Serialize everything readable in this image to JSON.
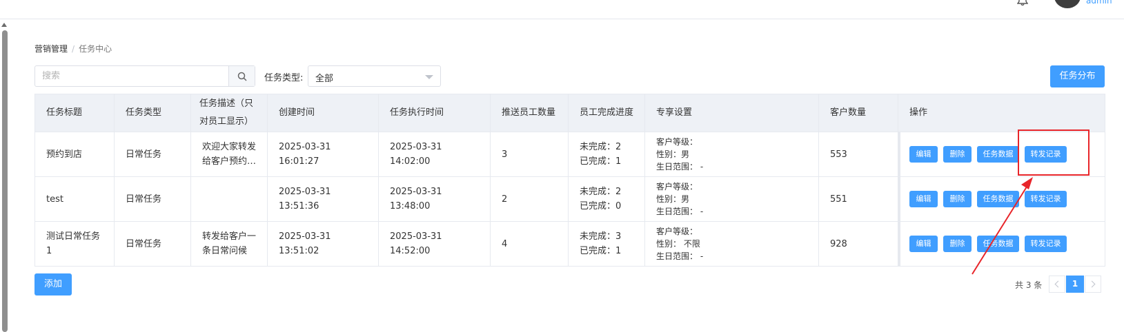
{
  "header": {
    "username": "admin",
    "icons": {
      "bell": "bell-icon",
      "avatar": "avatar"
    }
  },
  "breadcrumb": {
    "parent": "营销管理",
    "separator": "/",
    "current": "任务中心"
  },
  "toolbar": {
    "search_placeholder": "搜索",
    "search_icon": "search-icon",
    "type_label": "任务类型:",
    "type_value": "全部",
    "distribute_label": "任务分布"
  },
  "table": {
    "columns": [
      "任务标题",
      "任务类型",
      "任务描述（只对员工显示）",
      "创建时间",
      "任务执行时间",
      "推送员工数量",
      "员工完成进度",
      "专享设置",
      "客户数量",
      "操作"
    ],
    "rows": [
      {
        "title": "预约到店",
        "type": "日常任务",
        "desc": "欢迎大家转发给客户预约…",
        "created": "2025-03-31 16:01:27",
        "exec": "2025-03-31 14:02:00",
        "staff": "3",
        "unfinished": "未完成：2",
        "finished": "已完成：1",
        "level": "客户等级：",
        "gender": "性别：男",
        "birthday": "生日范围：  -",
        "customers": "553"
      },
      {
        "title": "test",
        "type": "日常任务",
        "desc": "",
        "created": "2025-03-31 13:51:36",
        "exec": "2025-03-31 13:48:00",
        "staff": "2",
        "unfinished": "未完成：2",
        "finished": "已完成：0",
        "level": "客户等级：",
        "gender": "性别：男",
        "birthday": "生日范围：  -",
        "customers": "551"
      },
      {
        "title": "测试日常任务1",
        "type": "日常任务",
        "desc": "转发给客户一条日常问候",
        "created": "2025-03-31 13:51:02",
        "exec": "2025-03-31 14:52:00",
        "staff": "4",
        "unfinished": "未完成：3",
        "finished": "已完成：1",
        "level": "客户等级：",
        "gender": "性别：  不限",
        "birthday": "生日范围：  -",
        "customers": "928"
      }
    ],
    "actions": {
      "edit": "编辑",
      "delete": "删除",
      "data": "任务数据",
      "forward": "转发记录"
    }
  },
  "footer": {
    "add_label": "添加",
    "total": "共 3 条",
    "current_page": "1"
  },
  "colors": {
    "primary": "#409eff",
    "annotation": "#e8252a",
    "header_bg": "#eef1f6"
  }
}
